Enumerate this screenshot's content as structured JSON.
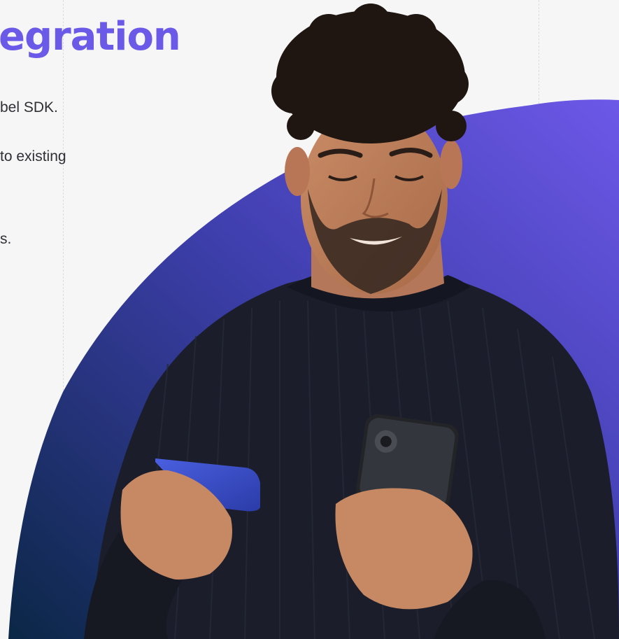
{
  "section": {
    "headline": "egration",
    "lines": [
      "bel SDK.",
      "to existing",
      "s."
    ]
  },
  "colors": {
    "headline": "#6b5ae8",
    "blob_top": "#6b57e6",
    "blob_mid": "#3f3fb0",
    "blob_bottom": "#0e2a4a",
    "background": "#f6f6f7"
  },
  "hero": {
    "description": "man holding a credit card and looking at a smartphone"
  }
}
